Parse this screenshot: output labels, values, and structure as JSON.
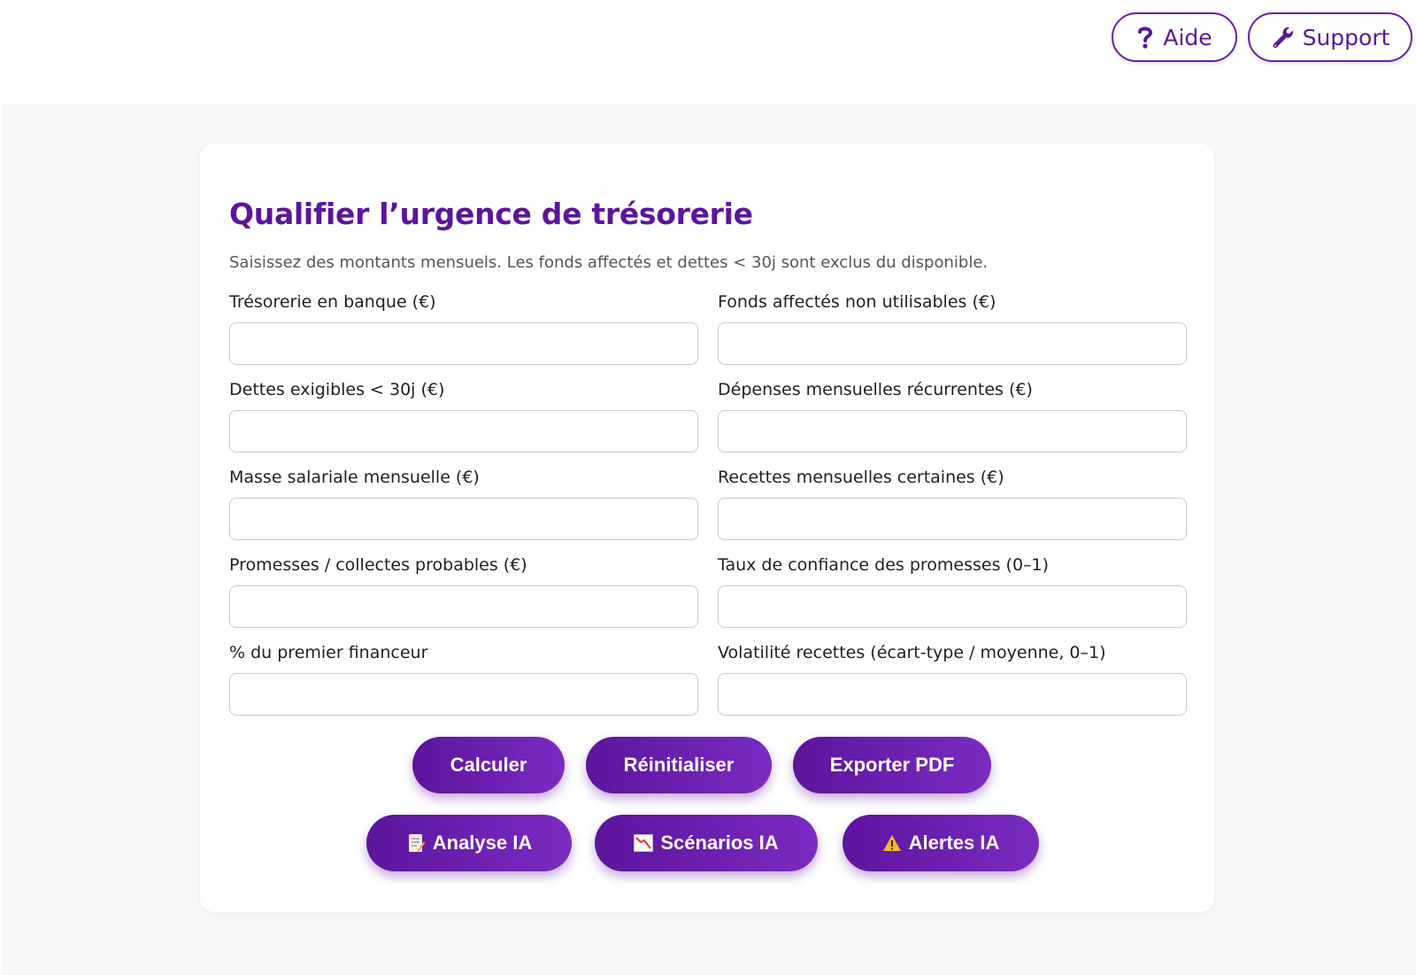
{
  "header": {
    "help_label": "Aide",
    "support_label": "Support"
  },
  "form": {
    "title": "Qualifier l’urgence de trésorerie",
    "subtitle": "Saisissez des montants mensuels. Les fonds affectés et dettes < 30j sont exclus du disponible.",
    "fields": [
      {
        "label": "Trésorerie en banque (€)",
        "value": "",
        "placeholder": ""
      },
      {
        "label": "Fonds affectés non utilisables (€)",
        "value": "",
        "placeholder": ""
      },
      {
        "label": "Dettes exigibles < 30j (€)",
        "value": "",
        "placeholder": ""
      },
      {
        "label": "Dépenses mensuelles récurrentes (€)",
        "value": "",
        "placeholder": ""
      },
      {
        "label": "Masse salariale mensuelle (€)",
        "value": "",
        "placeholder": ""
      },
      {
        "label": "Recettes mensuelles certaines (€)",
        "value": "",
        "placeholder": ""
      },
      {
        "label": "Promesses / collectes probables (€)",
        "value": "",
        "placeholder": ""
      },
      {
        "label": "Taux de confiance des promesses (0–1)",
        "value": "",
        "placeholder": ""
      },
      {
        "label": "% du premier financeur",
        "value": "",
        "placeholder": ""
      },
      {
        "label": "Volatilité recettes (écart-type / moyenne, 0–1)",
        "value": "",
        "placeholder": ""
      }
    ]
  },
  "actions": {
    "calculate": "Calculer",
    "reset": "Réinitialiser",
    "export_pdf": "Exporter PDF",
    "ai_analysis": "Analyse IA",
    "ai_scenarios": "Scénarios IA",
    "ai_alerts": "Alertes IA"
  },
  "icons": {
    "help": "question-mark-icon",
    "support": "wrench-icon",
    "ai_analysis": "memo-icon",
    "ai_scenarios": "chart-decreasing-icon",
    "ai_alerts": "warning-icon"
  },
  "colors": {
    "brand": "#5b159c",
    "button_gradient_start": "#5d149c",
    "button_gradient_end": "#7a2cc2",
    "page_background": "#f7f7f7"
  }
}
